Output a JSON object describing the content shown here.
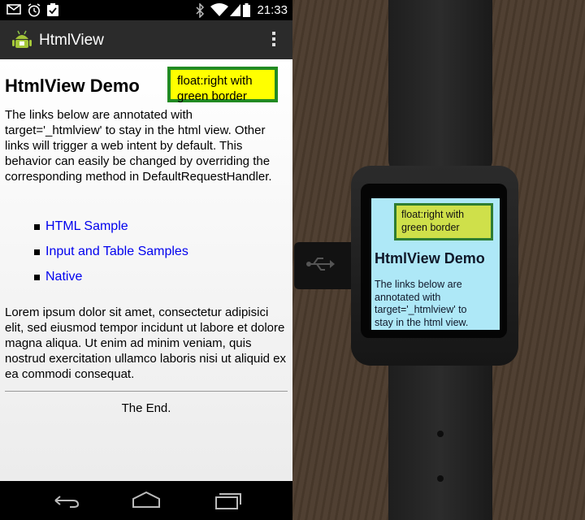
{
  "status_bar": {
    "time": "21:33",
    "icons": [
      "gmail-icon",
      "alarm-icon",
      "clipboard-check-icon",
      "bluetooth-icon",
      "wifi-icon",
      "signal-icon",
      "battery-icon"
    ]
  },
  "action_bar": {
    "app_title": "HtmlView",
    "app_icon": "android-icon",
    "overflow_icon": "overflow-menu-icon"
  },
  "page": {
    "float_box_text": "float:right with green border",
    "title": "HtmlView Demo",
    "intro": "The links below are annotated with target='_htmlview' to stay in the html view. Other links will trigger a web intent by default. This behavior can easily be changed by overriding the corresponding method in DefaultRequestHandler.",
    "links": [
      {
        "label": "HTML Sample"
      },
      {
        "label": "Input and Table Samples"
      },
      {
        "label": "Native"
      }
    ],
    "lorem": "Lorem ipsum dolor sit amet, consectetur adipisici elit, sed eiusmod tempor incidunt ut labore et dolore magna aliqua. Ut enim ad minim veniam, quis nostrud exercitation ullamco laboris nisi ut aliquid ex ea commodi consequat.",
    "the_end": "The End."
  },
  "nav_bar": {
    "icons": [
      "back-icon",
      "home-icon",
      "recent-apps-icon"
    ]
  },
  "watch": {
    "float_box_text": "float:right with green border",
    "title": "HtmlView Demo",
    "intro": "The links below are annotated with target='_htmlview' to stay in the html view."
  },
  "colors": {
    "link": "#0000ee",
    "float_box_bg": "#ffff00",
    "float_box_border": "#228b22",
    "action_bar": "#2b2b2b",
    "watch_screen": "#aee8f7"
  }
}
